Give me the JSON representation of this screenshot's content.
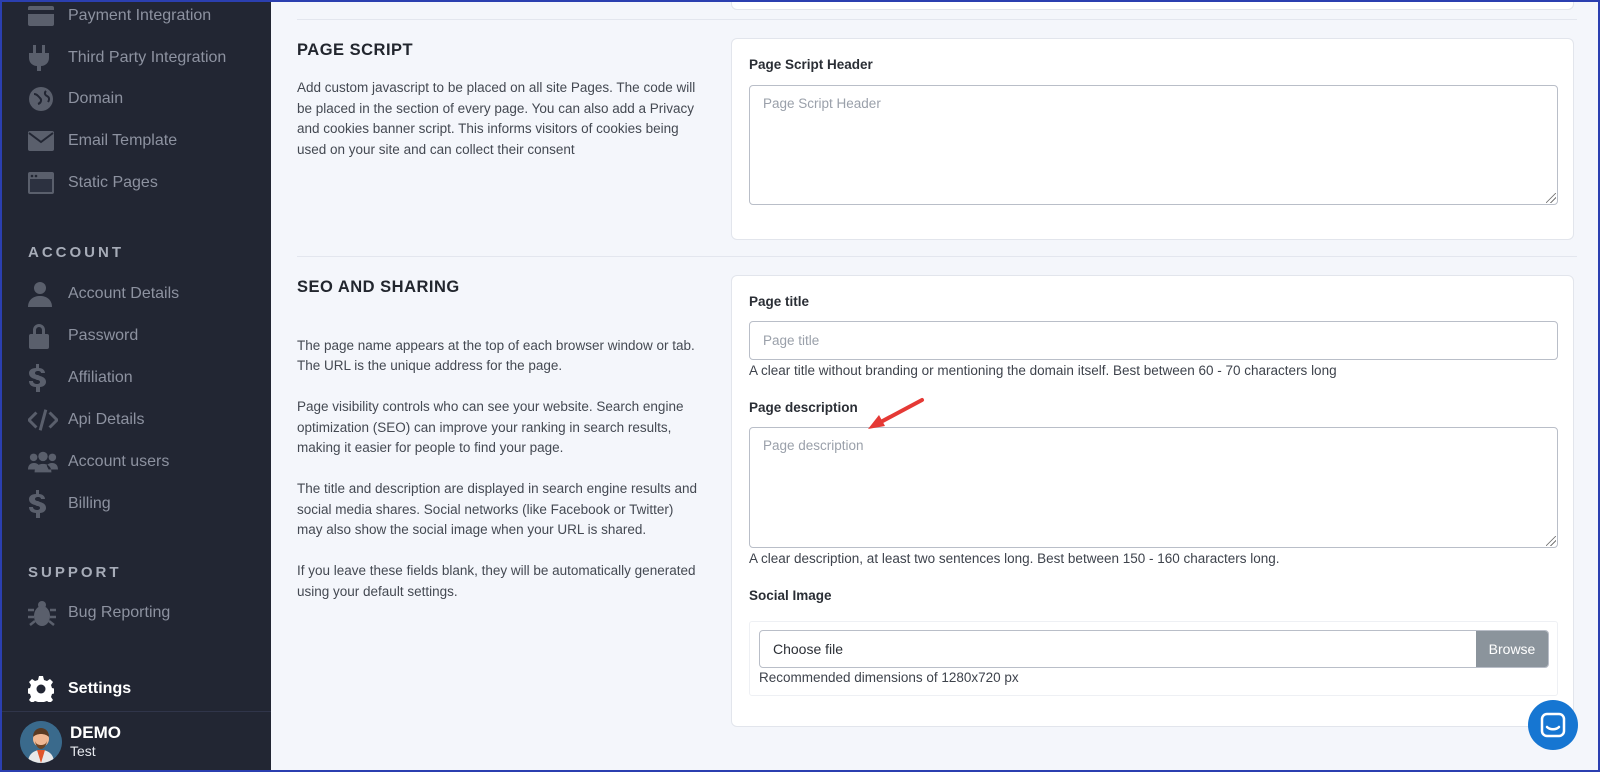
{
  "sidebar": {
    "items_top": [
      {
        "label": "Payment Integration",
        "icon": "payment-icon"
      },
      {
        "label": "Third Party Integration",
        "icon": "plug-icon"
      },
      {
        "label": "Domain",
        "icon": "globe-icon"
      },
      {
        "label": "Email Template",
        "icon": "envelope-icon"
      },
      {
        "label": "Static Pages",
        "icon": "window-icon"
      }
    ],
    "account_title": "ACCOUNT",
    "account_items": [
      {
        "label": "Account Details",
        "icon": "user-icon"
      },
      {
        "label": "Password",
        "icon": "lock-icon"
      },
      {
        "label": "Affiliation",
        "icon": "dollar-icon"
      },
      {
        "label": "Api Details",
        "icon": "code-icon"
      },
      {
        "label": "Account users",
        "icon": "users-icon"
      },
      {
        "label": "Billing",
        "icon": "dollar-icon"
      }
    ],
    "support_title": "SUPPORT",
    "support_items": [
      {
        "label": "Bug Reporting",
        "icon": "bug-icon"
      }
    ],
    "settings_label": "Settings",
    "user": {
      "name": "DEMO",
      "sub": "Test"
    }
  },
  "page_script": {
    "heading": "PAGE SCRIPT",
    "description": "Add custom javascript to be placed on all site Pages. The code will be placed in the section of every page. You can also add a Privacy and cookies banner script. This informs visitors of cookies being used on your site and can collect their consent",
    "field_label": "Page Script Header",
    "field_placeholder": "Page Script Header"
  },
  "seo": {
    "heading": "SEO AND SHARING",
    "description_lines": [
      "The page name appears at the top of each browser window or tab. The URL is the unique address for the page.",
      "Page visibility controls who can see your website. Search engine optimization (SEO) can improve your ranking in search results, making it easier for people to find your page.",
      "The title and description are displayed in search engine results and social media shares. Social networks (like Facebook or Twitter) may also show the social image when your URL is shared.",
      "If you leave these fields blank, they will be automatically generated using your default settings."
    ],
    "title_label": "Page title",
    "title_placeholder": "Page title",
    "title_hint": "A clear title without branding or mentioning the domain itself. Best between 60 - 70 characters long",
    "desc_label": "Page description",
    "desc_placeholder": "Page description",
    "desc_hint": "A clear description, at least two sentences long. Best between 150 - 160 characters long.",
    "image_label": "Social Image",
    "file_label": "Choose file",
    "browse_label": "Browse",
    "image_hint": "Recommended dimensions of 1280x720 px"
  },
  "colors": {
    "sidebar_bg": "#222633",
    "accent": "#1676d2",
    "annotation_arrow": "#e53935"
  }
}
